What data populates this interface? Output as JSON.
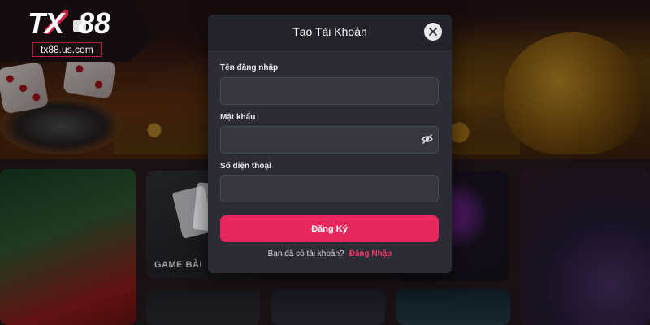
{
  "brand": {
    "logo_text": "TX88",
    "site_url": "tx88.us.com",
    "accent_color": "#e8285d"
  },
  "background": {
    "game_tile_label": "GAME BÀI"
  },
  "modal": {
    "title": "Tạo Tài Khoản",
    "close_icon": "close-icon",
    "fields": [
      {
        "label": "Tên đăng nhập",
        "value": "",
        "placeholder": ""
      },
      {
        "label": "Mật khẩu",
        "value": "",
        "placeholder": "",
        "icon": "eye-slash-icon"
      },
      {
        "label": "Số điện thoại",
        "value": "",
        "placeholder": ""
      }
    ],
    "submit_label": "Đăng Ký",
    "footer_text": "Bạn đã có tài khoản?",
    "login_link": "Đăng Nhập"
  }
}
